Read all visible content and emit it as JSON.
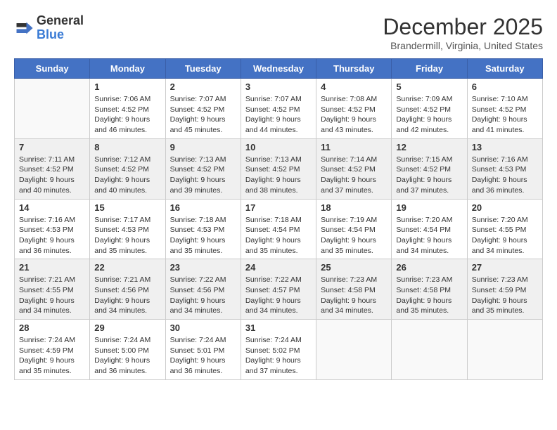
{
  "header": {
    "logo_line1": "General",
    "logo_line2": "Blue",
    "month": "December 2025",
    "location": "Brandermill, Virginia, United States"
  },
  "days_of_week": [
    "Sunday",
    "Monday",
    "Tuesday",
    "Wednesday",
    "Thursday",
    "Friday",
    "Saturday"
  ],
  "weeks": [
    [
      {
        "day": "",
        "info": ""
      },
      {
        "day": "1",
        "info": "Sunrise: 7:06 AM\nSunset: 4:52 PM\nDaylight: 9 hours\nand 46 minutes."
      },
      {
        "day": "2",
        "info": "Sunrise: 7:07 AM\nSunset: 4:52 PM\nDaylight: 9 hours\nand 45 minutes."
      },
      {
        "day": "3",
        "info": "Sunrise: 7:07 AM\nSunset: 4:52 PM\nDaylight: 9 hours\nand 44 minutes."
      },
      {
        "day": "4",
        "info": "Sunrise: 7:08 AM\nSunset: 4:52 PM\nDaylight: 9 hours\nand 43 minutes."
      },
      {
        "day": "5",
        "info": "Sunrise: 7:09 AM\nSunset: 4:52 PM\nDaylight: 9 hours\nand 42 minutes."
      },
      {
        "day": "6",
        "info": "Sunrise: 7:10 AM\nSunset: 4:52 PM\nDaylight: 9 hours\nand 41 minutes."
      }
    ],
    [
      {
        "day": "7",
        "info": "Sunrise: 7:11 AM\nSunset: 4:52 PM\nDaylight: 9 hours\nand 40 minutes."
      },
      {
        "day": "8",
        "info": "Sunrise: 7:12 AM\nSunset: 4:52 PM\nDaylight: 9 hours\nand 40 minutes."
      },
      {
        "day": "9",
        "info": "Sunrise: 7:13 AM\nSunset: 4:52 PM\nDaylight: 9 hours\nand 39 minutes."
      },
      {
        "day": "10",
        "info": "Sunrise: 7:13 AM\nSunset: 4:52 PM\nDaylight: 9 hours\nand 38 minutes."
      },
      {
        "day": "11",
        "info": "Sunrise: 7:14 AM\nSunset: 4:52 PM\nDaylight: 9 hours\nand 37 minutes."
      },
      {
        "day": "12",
        "info": "Sunrise: 7:15 AM\nSunset: 4:52 PM\nDaylight: 9 hours\nand 37 minutes."
      },
      {
        "day": "13",
        "info": "Sunrise: 7:16 AM\nSunset: 4:53 PM\nDaylight: 9 hours\nand 36 minutes."
      }
    ],
    [
      {
        "day": "14",
        "info": "Sunrise: 7:16 AM\nSunset: 4:53 PM\nDaylight: 9 hours\nand 36 minutes."
      },
      {
        "day": "15",
        "info": "Sunrise: 7:17 AM\nSunset: 4:53 PM\nDaylight: 9 hours\nand 35 minutes."
      },
      {
        "day": "16",
        "info": "Sunrise: 7:18 AM\nSunset: 4:53 PM\nDaylight: 9 hours\nand 35 minutes."
      },
      {
        "day": "17",
        "info": "Sunrise: 7:18 AM\nSunset: 4:54 PM\nDaylight: 9 hours\nand 35 minutes."
      },
      {
        "day": "18",
        "info": "Sunrise: 7:19 AM\nSunset: 4:54 PM\nDaylight: 9 hours\nand 35 minutes."
      },
      {
        "day": "19",
        "info": "Sunrise: 7:20 AM\nSunset: 4:54 PM\nDaylight: 9 hours\nand 34 minutes."
      },
      {
        "day": "20",
        "info": "Sunrise: 7:20 AM\nSunset: 4:55 PM\nDaylight: 9 hours\nand 34 minutes."
      }
    ],
    [
      {
        "day": "21",
        "info": "Sunrise: 7:21 AM\nSunset: 4:55 PM\nDaylight: 9 hours\nand 34 minutes."
      },
      {
        "day": "22",
        "info": "Sunrise: 7:21 AM\nSunset: 4:56 PM\nDaylight: 9 hours\nand 34 minutes."
      },
      {
        "day": "23",
        "info": "Sunrise: 7:22 AM\nSunset: 4:56 PM\nDaylight: 9 hours\nand 34 minutes."
      },
      {
        "day": "24",
        "info": "Sunrise: 7:22 AM\nSunset: 4:57 PM\nDaylight: 9 hours\nand 34 minutes."
      },
      {
        "day": "25",
        "info": "Sunrise: 7:23 AM\nSunset: 4:58 PM\nDaylight: 9 hours\nand 34 minutes."
      },
      {
        "day": "26",
        "info": "Sunrise: 7:23 AM\nSunset: 4:58 PM\nDaylight: 9 hours\nand 35 minutes."
      },
      {
        "day": "27",
        "info": "Sunrise: 7:23 AM\nSunset: 4:59 PM\nDaylight: 9 hours\nand 35 minutes."
      }
    ],
    [
      {
        "day": "28",
        "info": "Sunrise: 7:24 AM\nSunset: 4:59 PM\nDaylight: 9 hours\nand 35 minutes."
      },
      {
        "day": "29",
        "info": "Sunrise: 7:24 AM\nSunset: 5:00 PM\nDaylight: 9 hours\nand 36 minutes."
      },
      {
        "day": "30",
        "info": "Sunrise: 7:24 AM\nSunset: 5:01 PM\nDaylight: 9 hours\nand 36 minutes."
      },
      {
        "day": "31",
        "info": "Sunrise: 7:24 AM\nSunset: 5:02 PM\nDaylight: 9 hours\nand 37 minutes."
      },
      {
        "day": "",
        "info": ""
      },
      {
        "day": "",
        "info": ""
      },
      {
        "day": "",
        "info": ""
      }
    ]
  ]
}
